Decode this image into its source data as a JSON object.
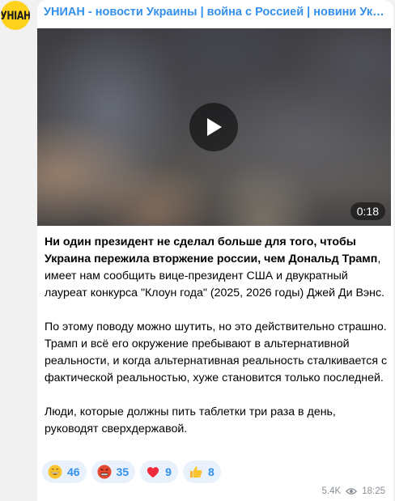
{
  "channel": {
    "title": "УНИАН - новости Украины | война с Россией | новини Україні...",
    "avatar_label": "УНІАН",
    "avatar_color": "#ffd21e",
    "title_color": "#3390ec"
  },
  "video": {
    "duration": "0:18",
    "play_icon": "play-icon"
  },
  "post": {
    "p1_bold": "Ни один президент не сделал больше для того, чтобы Украина пережила вторжение россии, чем Дональд Трамп",
    "p1_rest": ", имеет нам сообщить вице-президент США и двукратный лауреат конкурса \"Клоун года\" (2025, 2026 годы) Джей Ди Вэнс.",
    "p2": "По этому поводу можно шутить, но это действительно страшно. Трамп и всё его окружение пребывают в альтернативной реальности, и когда альтернативная реальность сталкивается с фактической реальностью, хуже становится только последней.",
    "p3": "Люди, которые должны пить таблетки три раза в день, руководят сверхдержавой."
  },
  "reactions": [
    {
      "icon": "grinning-face-icon",
      "count": "46"
    },
    {
      "icon": "angry-face-icon",
      "count": "35"
    },
    {
      "icon": "red-heart-icon",
      "count": "9"
    },
    {
      "icon": "thumbs-up-icon",
      "count": "8"
    }
  ],
  "meta": {
    "views": "5.4K",
    "views_icon": "eye-icon",
    "time": "18:25"
  }
}
